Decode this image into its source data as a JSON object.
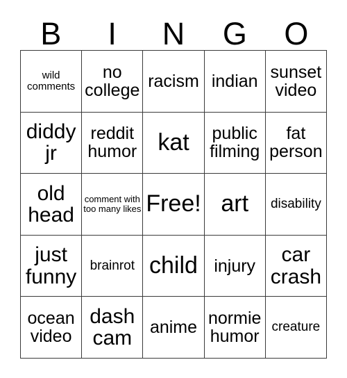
{
  "card": {
    "header": {
      "letters": [
        "B",
        "I",
        "N",
        "G",
        "O"
      ]
    },
    "grid": {
      "rows": 5,
      "columns": 5,
      "border_color": "#3a3a3a",
      "background_color": "#ffffff",
      "text_color": "#000000",
      "cells": [
        [
          {
            "text": "wild comments",
            "size": "xs"
          },
          {
            "text": "no college",
            "size": "md"
          },
          {
            "text": "racism",
            "size": "md"
          },
          {
            "text": "indian",
            "size": "md"
          },
          {
            "text": "sunset video",
            "size": "md"
          }
        ],
        [
          {
            "text": "diddy jr",
            "size": "lg"
          },
          {
            "text": "reddit humor",
            "size": "md"
          },
          {
            "text": "kat",
            "size": "xl"
          },
          {
            "text": "public filming",
            "size": "md"
          },
          {
            "text": "fat person",
            "size": "md"
          }
        ],
        [
          {
            "text": "old head",
            "size": "lg"
          },
          {
            "text": "comment with too many likes",
            "size": "xxs"
          },
          {
            "text": "Free!",
            "size": "xl"
          },
          {
            "text": "art",
            "size": "xl"
          },
          {
            "text": "disability",
            "size": "sm"
          }
        ],
        [
          {
            "text": "just funny",
            "size": "lg"
          },
          {
            "text": "brainrot",
            "size": "sm"
          },
          {
            "text": "child",
            "size": "xl"
          },
          {
            "text": "injury",
            "size": "md"
          },
          {
            "text": "car crash",
            "size": "lg"
          }
        ],
        [
          {
            "text": "ocean video",
            "size": "md"
          },
          {
            "text": "dash cam",
            "size": "lg"
          },
          {
            "text": "anime",
            "size": "md"
          },
          {
            "text": "normie humor",
            "size": "md"
          },
          {
            "text": "creature",
            "size": "sm"
          }
        ]
      ]
    }
  }
}
